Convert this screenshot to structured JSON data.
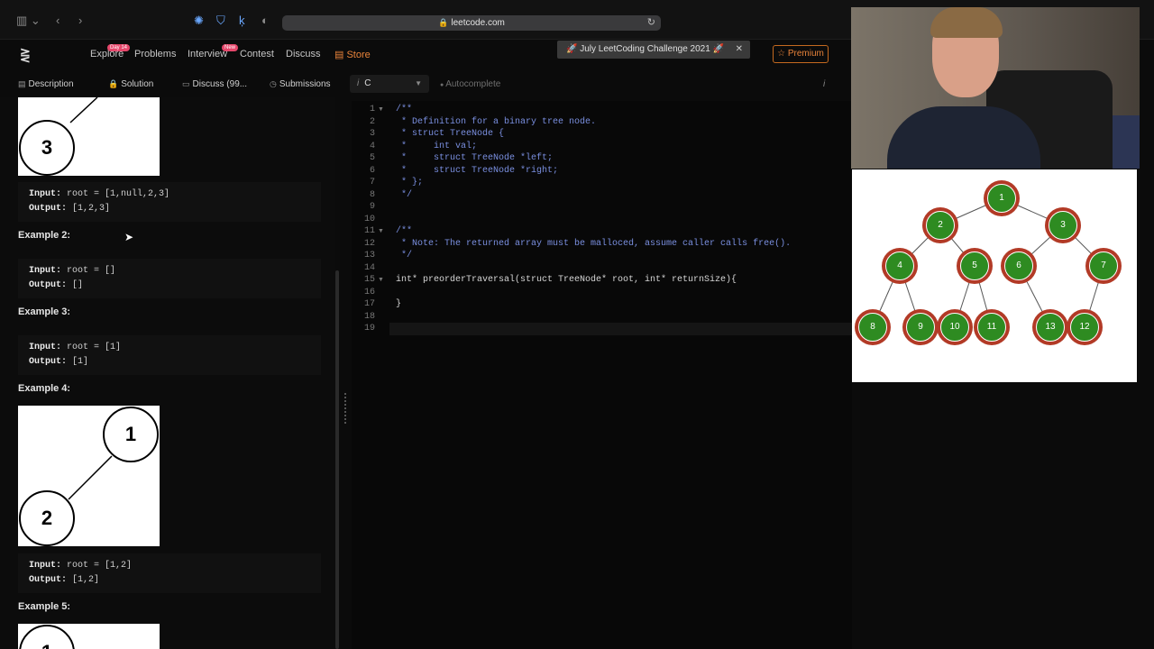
{
  "browser": {
    "url": "leetcode.com"
  },
  "nav": {
    "explore": "Explore",
    "explore_badge": "Day 14",
    "problems": "Problems",
    "interview": "Interview",
    "interview_badge": "New",
    "contest": "Contest",
    "discuss": "Discuss",
    "store": "Store",
    "challenge": "🚀 July LeetCoding Challenge 2021 🚀",
    "premium": "☆ Premium"
  },
  "tabs": {
    "description": "Description",
    "solution": "Solution",
    "discuss": "Discuss (99...",
    "submissions": "Submissions"
  },
  "editor_toolbar": {
    "language": "C",
    "autocomplete": "Autocomplete"
  },
  "description": {
    "example1_input_label": "Input:",
    "example1_input": " root = [1,null,2,3]",
    "example1_output_label": "Output:",
    "example1_output": " [1,2,3]",
    "example2_title": "Example 2:",
    "example2_input_label": "Input:",
    "example2_input": " root = []",
    "example2_output_label": "Output:",
    "example2_output": " []",
    "example3_title": "Example 3:",
    "example3_input_label": "Input:",
    "example3_input": " root = [1]",
    "example3_output_label": "Output:",
    "example3_output": " [1]",
    "example4_title": "Example 4:",
    "example4_input_label": "Input:",
    "example4_input": " root = [1,2]",
    "example4_output_label": "Output:",
    "example4_output": " [1,2]",
    "example5_title": "Example 5:",
    "img1_node": "3",
    "img4_node_a": "1",
    "img4_node_b": "2",
    "img5_node": "1"
  },
  "code": {
    "lines": [
      {
        "n": "1",
        "text": "/**",
        "cls": "cmt",
        "fold": true
      },
      {
        "n": "2",
        "text": " * Definition for a binary tree node.",
        "cls": "cmt"
      },
      {
        "n": "3",
        "text": " * struct TreeNode {",
        "cls": "cmt"
      },
      {
        "n": "4",
        "text": " *     int val;",
        "cls": "cmt"
      },
      {
        "n": "5",
        "text": " *     struct TreeNode *left;",
        "cls": "cmt"
      },
      {
        "n": "6",
        "text": " *     struct TreeNode *right;",
        "cls": "cmt"
      },
      {
        "n": "7",
        "text": " * };",
        "cls": "cmt"
      },
      {
        "n": "8",
        "text": " */",
        "cls": "cmt"
      },
      {
        "n": "9",
        "text": "",
        "cls": "fn"
      },
      {
        "n": "10",
        "text": "",
        "cls": "fn"
      },
      {
        "n": "11",
        "text": "/**",
        "cls": "cmt",
        "fold": true
      },
      {
        "n": "12",
        "text": " * Note: The returned array must be malloced, assume caller calls free().",
        "cls": "cmt"
      },
      {
        "n": "13",
        "text": " */",
        "cls": "cmt"
      },
      {
        "n": "14",
        "text": "",
        "cls": "fn"
      },
      {
        "n": "15",
        "text": "int* preorderTraversal(struct TreeNode* root, int* returnSize){",
        "cls": "fn",
        "fold": true
      },
      {
        "n": "16",
        "text": "",
        "cls": "fn"
      },
      {
        "n": "17",
        "text": "}",
        "cls": "fn"
      },
      {
        "n": "18",
        "text": "",
        "cls": "fn"
      },
      {
        "n": "19",
        "text": "",
        "cls": "fn"
      }
    ]
  },
  "diagram": {
    "nodes": [
      "1",
      "2",
      "3",
      "4",
      "5",
      "6",
      "7",
      "8",
      "9",
      "10",
      "11",
      "13",
      "12"
    ],
    "edges": [
      [
        "1",
        "2"
      ],
      [
        "1",
        "3"
      ],
      [
        "2",
        "4"
      ],
      [
        "2",
        "5"
      ],
      [
        "3",
        "6"
      ],
      [
        "3",
        "7"
      ],
      [
        "4",
        "8"
      ],
      [
        "4",
        "9"
      ],
      [
        "5",
        "10"
      ],
      [
        "5",
        "11"
      ],
      [
        "6",
        "13"
      ],
      [
        "7",
        "12"
      ]
    ]
  }
}
